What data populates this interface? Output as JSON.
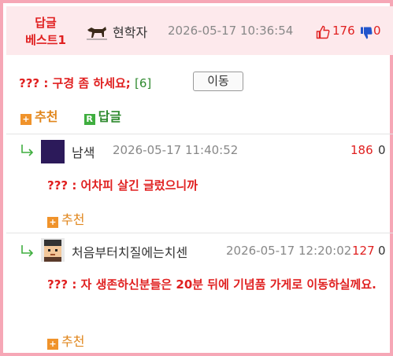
{
  "best": {
    "label_line1": "답글",
    "label_line2": "베스트1",
    "writer": "현학자",
    "date": "2026-05-17 10:36:54",
    "up_count": "176",
    "down_count": "0"
  },
  "comment": {
    "text": "??? : 구경 좀 하세요;",
    "reply_count": "[6]",
    "move_label": "이동",
    "recommend_label": "추천",
    "reply_label": "답글",
    "recommend_icon_glyph": "+",
    "reply_icon_glyph": "R"
  },
  "replies": [
    {
      "name": "남색",
      "date": "2026-05-17 11:40:52",
      "up": "186",
      "down": "0",
      "body": "??? : 어차피 살긴 글렀으니까",
      "recommend_label": "추천"
    },
    {
      "name": "처음부터치질에는치센",
      "date": "2026-05-17 12:20:02",
      "up": "127",
      "down": "0",
      "body": "??? : 자 생존하신분들은 20분 뒤에 기념품 가게로 이동하실께요.",
      "recommend_label": "추천"
    }
  ],
  "colors": {
    "border": "#f6a7b6",
    "header_bg": "#fde9ec",
    "accent_red": "#e02020",
    "recommend_orange": "#e0861c",
    "reply_green": "#2f8a2f"
  }
}
